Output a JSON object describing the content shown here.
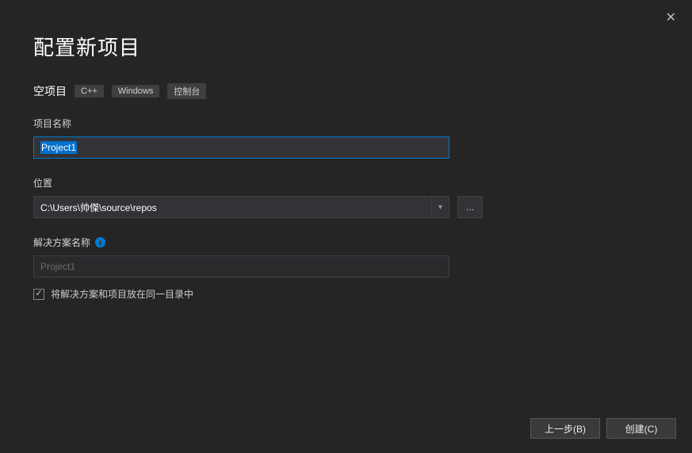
{
  "close_symbol": "✕",
  "title": "配置新项目",
  "template_name": "空项目",
  "tags": [
    "C++",
    "Windows",
    "控制台"
  ],
  "labels": {
    "project_name": "项目名称",
    "location": "位置",
    "solution_name": "解决方案名称"
  },
  "fields": {
    "project_name": "Project1",
    "location": "C:\\Users\\帅傑\\source\\repos",
    "solution_name_placeholder": "Project1"
  },
  "dropdown_arrow": "▾",
  "browse_label": "...",
  "info_symbol": "i",
  "checkbox": {
    "checked_mark": "✓",
    "label": "将解决方案和项目放在同一目录中"
  },
  "buttons": {
    "back": "上一步(B)",
    "create": "创建(C)"
  }
}
